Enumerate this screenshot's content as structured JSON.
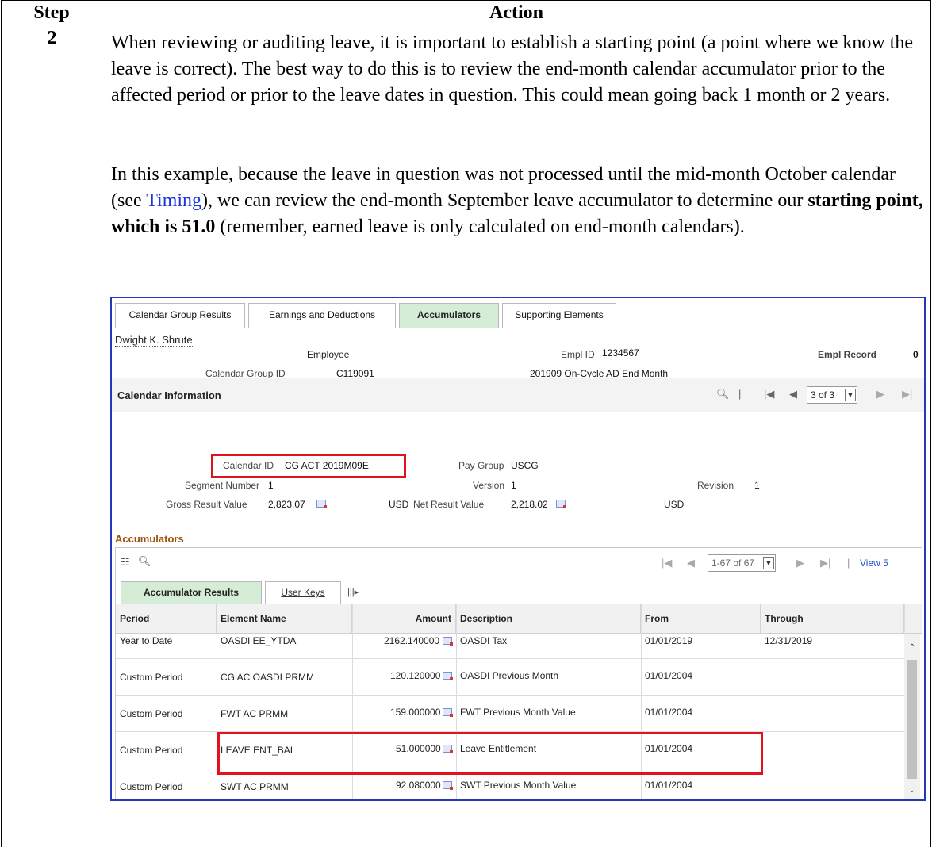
{
  "doc": {
    "header_step": "Step",
    "header_action": "Action",
    "step_number": "2",
    "para1": "When reviewing or auditing leave, it is important to establish a starting point (a point where we know the leave is correct).  The best way to do this is to review the end-month calendar accumulator prior to the affected period or prior to the leave dates in question.  This could mean going back 1 month or 2 years.",
    "para2_a": "In this example, because the leave in question was not processed until the mid-month October calendar (see ",
    "para2_link": "Timing",
    "para2_b": "), we can review the end-month September leave accumulator to determine our ",
    "para2_bold": "starting point, which is 51.0",
    "para2_c": " (remember, earned leave is only calculated on end-month calendars)."
  },
  "ps": {
    "tabs": [
      {
        "label": "Calendar Group Results"
      },
      {
        "label": "Earnings and Deductions"
      },
      {
        "label": "Accumulators"
      },
      {
        "label": "Supporting Elements"
      }
    ],
    "employee_name": "Dwight K. Shrute",
    "employee_label": "Employee",
    "empl_id_label": "Empl ID",
    "empl_id": "1234567",
    "empl_record_label": "Empl Record",
    "empl_record": "0",
    "calendar_group_id_label": "Calendar Group ID",
    "calendar_group_id": "C119091",
    "calendar_group_desc": "201909 On-Cycle AD End Month",
    "calendar_info_title": "Calendar Information",
    "pager": "3 of 3",
    "calendar_id_label": "Calendar ID",
    "calendar_id": "CG ACT 2019M09E",
    "pay_group_label": "Pay Group",
    "pay_group": "USCG",
    "segment_number_label": "Segment Number",
    "segment_number": "1",
    "version_label": "Version",
    "version": "1",
    "revision_label": "Revision",
    "revision": "1",
    "gross_result_label": "Gross Result Value",
    "gross_result": "2,823.07",
    "gross_currency": "USD",
    "net_result_label": "Net Result Value",
    "net_result": "2,218.02",
    "net_currency": "USD",
    "accumulators_title": "Accumulators",
    "grid_pager": "1-67 of 67",
    "view_link": "View 5",
    "inner_tabs": [
      {
        "label": "Accumulator Results"
      },
      {
        "label": "User Keys"
      }
    ],
    "columns": [
      "Period",
      "Element Name",
      "Amount",
      "Description",
      "From",
      "Through"
    ],
    "rows": [
      {
        "period": "Year to Date",
        "element": "OASDI EE_YTDA",
        "amount": "2162.140000",
        "description": "OASDI Tax",
        "from": "01/01/2019",
        "through": "12/31/2019"
      },
      {
        "period": "Custom Period",
        "element": "CG AC OASDI PRMM",
        "amount": "120.120000",
        "description": "OASDI Previous Month",
        "from": "01/01/2004",
        "through": ""
      },
      {
        "period": "Custom Period",
        "element": "FWT AC PRMM",
        "amount": "159.000000",
        "description": "FWT Previous Month Value",
        "from": "01/01/2004",
        "through": ""
      },
      {
        "period": "Custom Period",
        "element": "LEAVE ENT_BAL",
        "amount": "51.000000",
        "description": "Leave Entitlement",
        "from": "01/01/2004",
        "through": ""
      },
      {
        "period": "Custom Period",
        "element": "SWT AC PRMM",
        "amount": "92.080000",
        "description": "SWT Previous Month Value",
        "from": "01/01/2004",
        "through": ""
      }
    ]
  }
}
